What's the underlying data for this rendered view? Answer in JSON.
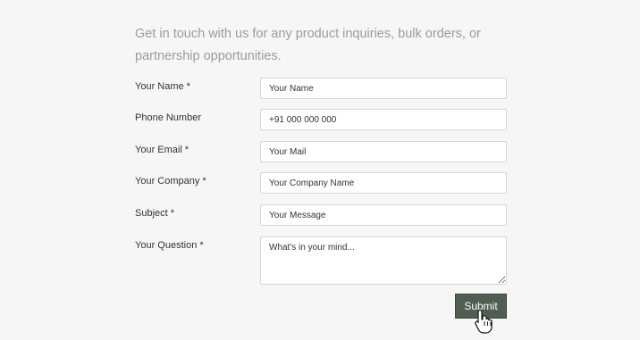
{
  "intro_text": "Get in touch with us for any product inquiries, bulk orders, or partnership opportunities.",
  "form": {
    "fields": [
      {
        "label": "Your Name",
        "required": "*",
        "placeholder": "Your Name",
        "value": ""
      },
      {
        "label": "Phone Number",
        "required": "",
        "placeholder": "",
        "value": "+91 000 000 000"
      },
      {
        "label": "Your Email",
        "required": "*",
        "placeholder": "Your Mail",
        "value": ""
      },
      {
        "label": "Your Company",
        "required": "*",
        "placeholder": "Your Company Name",
        "value": ""
      },
      {
        "label": "Subject",
        "required": "*",
        "placeholder": "Your Message",
        "value": ""
      },
      {
        "label": "Your Question",
        "required": "*",
        "placeholder": "What's in your mind...",
        "value": ""
      }
    ],
    "submit_label": "Submit"
  },
  "colors": {
    "background": "#f6f6f6",
    "button_bg": "#4f5d52",
    "intro_text": "#9b9b9b"
  },
  "icons": {
    "cursor": "hand-pointer-icon"
  }
}
